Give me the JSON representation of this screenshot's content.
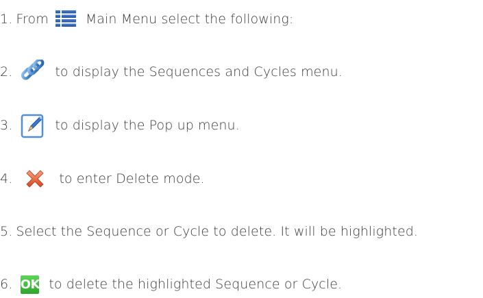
{
  "steps": [
    {
      "number": "1.",
      "prefix": "From",
      "icon": "main-menu-list-icon",
      "text": "Main Menu select the following:"
    },
    {
      "number": "2.",
      "icon": "chain-link-icon",
      "text": "to display the Sequences and Cycles menu."
    },
    {
      "number": "3.",
      "icon": "edit-pencil-icon",
      "text": "to display the Pop up menu."
    },
    {
      "number": "4.",
      "icon": "delete-x-icon",
      "text": "to enter Delete mode."
    },
    {
      "number": "5.",
      "text": "Select the Sequence or Cycle to delete. It will be highlighted."
    },
    {
      "number": "6.",
      "icon": "ok-button-icon",
      "icon_label": "OK",
      "text": "to delete the highlighted Sequence or Cycle."
    }
  ],
  "colors": {
    "text": "#3a3a3a",
    "menu_icon": "#2b5fb0",
    "link_icon": "#2f7fd0",
    "delete_icon": "#e8632a",
    "ok_icon": "#3bb537"
  }
}
